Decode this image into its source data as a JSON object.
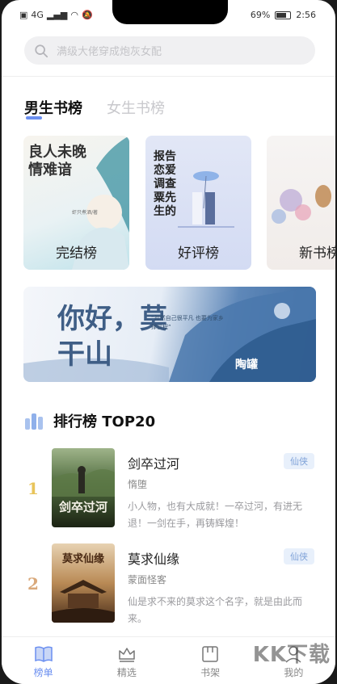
{
  "status_bar": {
    "signal": "4G",
    "battery": "69%",
    "time": "2:56"
  },
  "search": {
    "placeholder": "满级大佬穿成炮灰女配"
  },
  "tabs": [
    {
      "label": "男生书榜",
      "active": true
    },
    {
      "label": "女生书榜",
      "active": false
    }
  ],
  "list_cards": [
    {
      "label": "完结榜",
      "cover_text": "良人未晚 情难谙",
      "cover_sub": "虾只煮酒/著"
    },
    {
      "label": "好评榜",
      "cover_text": "报告 恋爱调查 粟先生的"
    },
    {
      "label": "新书榜"
    }
  ],
  "banner": {
    "headline": "你好，莫干山",
    "quote": "“忽然自己很平凡 也要为家乡撑前程”",
    "brand": "陶罐"
  },
  "ranking": {
    "title": "排行榜 TOP20",
    "books": [
      {
        "rank": "1",
        "title": "剑卒过河",
        "author": "惰堕",
        "tag": "仙侠",
        "description": "小人物，也有大成就！一卒过河，有进无退！一剑在手，再铸辉煌！",
        "cover_title": "剑卒过河"
      },
      {
        "rank": "2",
        "title": "莫求仙缘",
        "author": "蒙面怪客",
        "tag": "仙侠",
        "description": "仙是求不来的莫求这个名字，就是由此而来。",
        "cover_title": "莫求仙缘"
      }
    ]
  },
  "bottom_nav": [
    {
      "label": "榜单",
      "icon": "book-open-icon",
      "active": true
    },
    {
      "label": "精选",
      "icon": "crown-icon",
      "active": false
    },
    {
      "label": "书架",
      "icon": "bookshelf-icon",
      "active": false
    },
    {
      "label": "我的",
      "icon": "user-icon",
      "active": false
    }
  ],
  "watermark": "KK下载",
  "colors": {
    "accent": "#6b8ff0",
    "tag_bg": "#e8f0fb",
    "tag_text": "#7fa2d8",
    "rank1": "#e8c45a",
    "rank2": "#d9a87a"
  }
}
